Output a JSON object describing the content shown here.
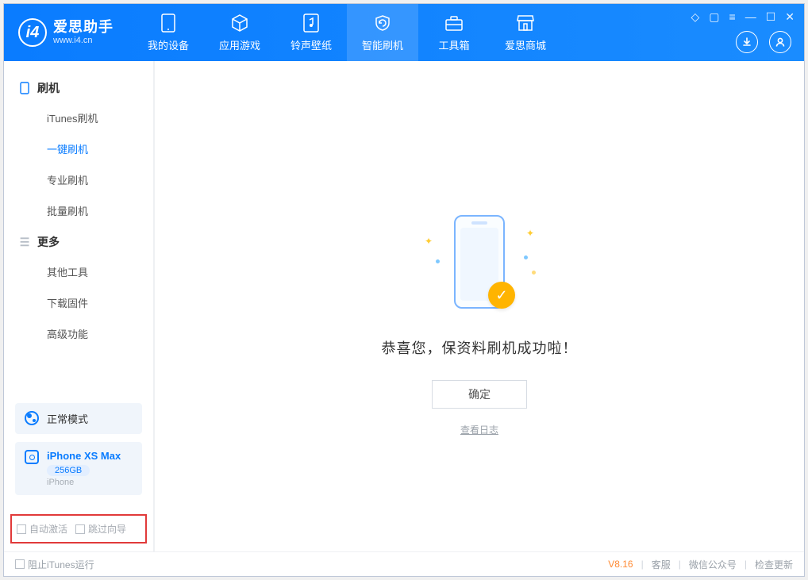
{
  "app": {
    "name": "爱思助手",
    "site": "www.i4.cn"
  },
  "nav": {
    "device": "我的设备",
    "apps": "应用游戏",
    "ring": "铃声壁纸",
    "flash": "智能刷机",
    "tools": "工具箱",
    "store": "爱思商城"
  },
  "sidebar": {
    "group_flash": "刷机",
    "itunes_flash": "iTunes刷机",
    "one_click": "一键刷机",
    "pro_flash": "专业刷机",
    "batch_flash": "批量刷机",
    "group_more": "更多",
    "other_tools": "其他工具",
    "download_fw": "下载固件",
    "advanced": "高级功能"
  },
  "device": {
    "mode": "正常模式",
    "name": "iPhone XS Max",
    "storage": "256GB",
    "type": "iPhone"
  },
  "options": {
    "auto_activate": "自动激活",
    "skip_wizard": "跳过向导"
  },
  "main": {
    "success_msg": "恭喜您，保资料刷机成功啦！",
    "ok": "确定",
    "view_log": "查看日志"
  },
  "status": {
    "block_itunes": "阻止iTunes运行",
    "version": "V8.16",
    "support": "客服",
    "wechat": "微信公众号",
    "check_update": "检查更新"
  }
}
